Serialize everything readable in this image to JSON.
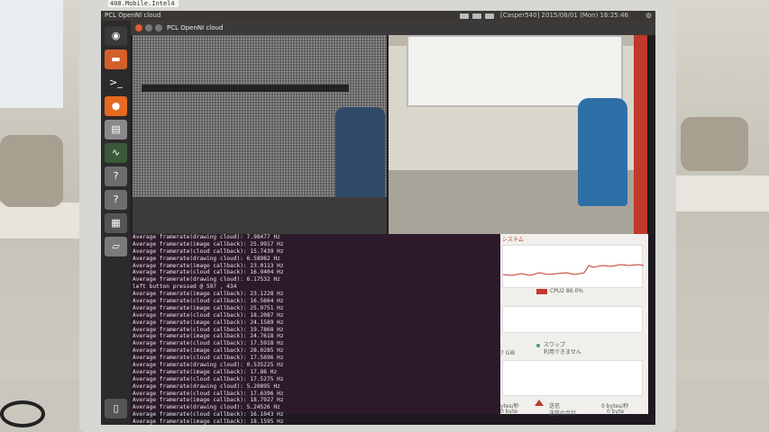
{
  "sticker": {
    "text": "408.Mobile.Intel4"
  },
  "topbar": {
    "window_title": "PCL OpenNI cloud",
    "clock": "[Casper540] 2015/08/01 (Mon) 16:25:46"
  },
  "launcher": {
    "items": [
      {
        "icon": "ubuntu-dash-icon",
        "glyph": "◉",
        "color": "#3a3a3a"
      },
      {
        "icon": "files-icon",
        "glyph": "▬",
        "color": "#d35f2b"
      },
      {
        "icon": "terminal-icon",
        "glyph": ">_",
        "color": "#2b2b2b"
      },
      {
        "icon": "firefox-icon",
        "glyph": "●",
        "color": "#e66a1f"
      },
      {
        "icon": "document-viewer-icon",
        "glyph": "▤",
        "color": "#8a8a8a"
      },
      {
        "icon": "system-monitor-icon",
        "glyph": "∿",
        "color": "#3a5a3a"
      },
      {
        "icon": "unknown-app-icon",
        "glyph": "?",
        "color": "#6d6d6d"
      },
      {
        "icon": "unknown-app-icon",
        "glyph": "?",
        "color": "#6d6d6d"
      },
      {
        "icon": "workspaces-icon",
        "glyph": "▦",
        "color": "#555555"
      },
      {
        "icon": "drive-icon",
        "glyph": "▱",
        "color": "#7a7a7a"
      },
      {
        "icon": "trash-icon",
        "glyph": "▯",
        "color": "#555555"
      }
    ]
  },
  "pcl_window": {
    "title": "PCL OpenNI cloud"
  },
  "terminal": {
    "lines": [
      "Average framerate(drawing cloud): 7.98477 Hz",
      "Average framerate(image callback): 25.9917 Hz",
      "Average framerate(cloud callback): 15.7439 Hz",
      "Average framerate(drawing cloud): 6.58982 Hz",
      "Average framerate(image callback): 23.0113 Hz",
      "Average framerate(cloud callback): 16.9404 Hz",
      "Average framerate(drawing cloud): 6.17532 Hz",
      "left button pressed @ 597 , 434",
      "Average framerate(image callback): 23.1228 Hz",
      "Average framerate(cloud callback): 16.5664 Hz",
      "Average framerate(image callback): 25.9751 Hz",
      "Average framerate(cloud callback): 18.2087 Hz",
      "Average framerate(image callback): 24.1589 Hz",
      "Average framerate(cloud callback): 19.7868 Hz",
      "Average framerate(image callback): 24.7618 Hz",
      "Average framerate(cloud callback): 17.5918 Hz",
      "Average framerate(image callback): 28.0285 Hz",
      "Average framerate(cloud callback): 17.5696 Hz",
      "Average framerate(drawing cloud): 0.535225 Hz",
      "Average framerate(image callback): 17.86 Hz",
      "Average framerate(cloud callback): 17.5275 Hz",
      "Average framerate(drawing cloud): 5.20895 Hz",
      "Average framerate(cloud callback): 17.6396 Hz",
      "Average framerate(image callback): 18.7927 Hz",
      "Average framerate(drawing cloud): 5.24526 Hz",
      "Average framerate(cloud callback): 16.1043 Hz",
      "Average framerate(image callback): 18.1595 Hz"
    ]
  },
  "system_monitor": {
    "header": "システム",
    "cpu_label": "CPU2 86.0%",
    "swap_label": "スワップ",
    "swap_value": "利用できません",
    "gib_label": "7 GiB",
    "recv_label": "ytes/秒",
    "recv_total": "0 byte",
    "send_label": "送信",
    "send_total": "送信の合計",
    "send_rate": "0 bytes/秒",
    "send_bytes": "0 byte",
    "accent_color": "#c0392b"
  }
}
